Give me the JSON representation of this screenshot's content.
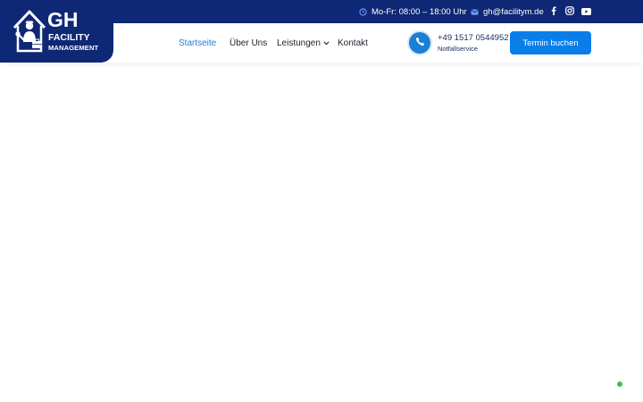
{
  "colors": {
    "navy": "#0f2875",
    "accent_blue": "#1b7fd6",
    "button_blue": "#0a7ee8",
    "chat_green": "#2fc553"
  },
  "topbar": {
    "hours": {
      "icon": "clock-icon",
      "text": "Mo-Fr: 08:00 – 18:00 Uhr"
    },
    "email": {
      "icon": "mail-icon",
      "text": "gh@facilitym.de"
    },
    "social": [
      {
        "icon": "facebook-icon"
      },
      {
        "icon": "instagram-icon"
      },
      {
        "icon": "youtube-icon"
      }
    ]
  },
  "logo": {
    "icon": "house-worker-logo-icon",
    "mark": "GH",
    "line1": "FACILITY",
    "line2": "MANAGEMENT"
  },
  "nav": {
    "items": [
      {
        "label": "Startseite",
        "active": true
      },
      {
        "label": "Über Uns"
      },
      {
        "label": "Leistungen",
        "icon": "chevron-down-icon"
      },
      {
        "label": "Kontakt"
      }
    ]
  },
  "contact": {
    "icon": "phone-icon",
    "phone": "+49 1517 0544952",
    "subtitle": "Notfallservice"
  },
  "cta": {
    "label": "Termin buchen"
  },
  "chat": {
    "icon": "chat-widget-icon"
  }
}
